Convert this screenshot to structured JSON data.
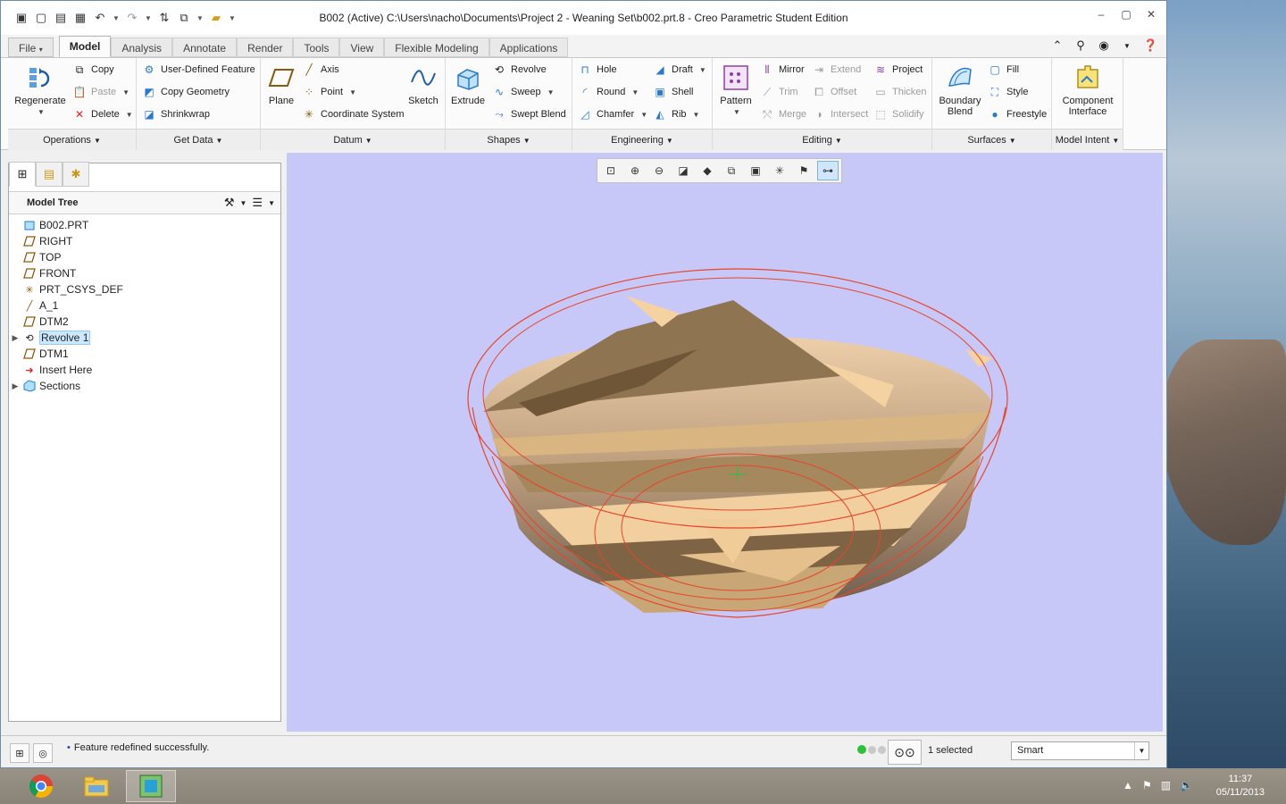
{
  "window": {
    "title": "B002 (Active) C:\\Users\\nacho\\Documents\\Project 2 - Weaning Set\\b002.prt.8 - Creo Parametric Student Edition"
  },
  "tabs": [
    {
      "label": "File",
      "id": "file"
    },
    {
      "label": "Model",
      "id": "model"
    },
    {
      "label": "Analysis",
      "id": "analysis"
    },
    {
      "label": "Annotate",
      "id": "annotate"
    },
    {
      "label": "Render",
      "id": "render"
    },
    {
      "label": "Tools",
      "id": "tools"
    },
    {
      "label": "View",
      "id": "view"
    },
    {
      "label": "Flexible Modeling",
      "id": "flexible"
    },
    {
      "label": "Applications",
      "id": "applications"
    }
  ],
  "ribbon": {
    "operations": {
      "label": "Operations",
      "regenerate": "Regenerate",
      "copy": "Copy",
      "paste": "Paste",
      "delete": "Delete"
    },
    "getdata": {
      "label": "Get Data",
      "udf": "User-Defined Feature",
      "copy_geometry": "Copy Geometry",
      "shrinkwrap": "Shrinkwrap"
    },
    "datum": {
      "label": "Datum",
      "plane": "Plane",
      "axis": "Axis",
      "point": "Point",
      "csys": "Coordinate System",
      "sketch": "Sketch"
    },
    "shapes": {
      "label": "Shapes",
      "extrude": "Extrude",
      "revolve": "Revolve",
      "sweep": "Sweep",
      "swept_blend": "Swept Blend"
    },
    "engineering": {
      "label": "Engineering",
      "hole": "Hole",
      "round": "Round",
      "chamfer": "Chamfer",
      "draft": "Draft",
      "shell": "Shell",
      "rib": "Rib"
    },
    "editing": {
      "label": "Editing",
      "pattern": "Pattern",
      "mirror": "Mirror",
      "trim": "Trim",
      "merge": "Merge",
      "extend": "Extend",
      "offset": "Offset",
      "intersect": "Intersect",
      "project": "Project",
      "thicken": "Thicken",
      "solidify": "Solidify"
    },
    "surfaces": {
      "label": "Surfaces",
      "boundary_blend_1": "Boundary",
      "boundary_blend_2": "Blend",
      "fill": "Fill",
      "style": "Style",
      "freestyle": "Freestyle"
    },
    "model_intent": {
      "label": "Model Intent",
      "component_1": "Component",
      "component_2": "Interface"
    }
  },
  "model_tree": {
    "title": "Model Tree",
    "items": [
      {
        "label": "B002.PRT",
        "icon": "part-icon",
        "expander": ""
      },
      {
        "label": "RIGHT",
        "icon": "datum-plane-icon",
        "expander": ""
      },
      {
        "label": "TOP",
        "icon": "datum-plane-icon",
        "expander": ""
      },
      {
        "label": "FRONT",
        "icon": "datum-plane-icon",
        "expander": ""
      },
      {
        "label": "PRT_CSYS_DEF",
        "icon": "csys-icon",
        "expander": ""
      },
      {
        "label": "A_1",
        "icon": "axis-icon",
        "expander": ""
      },
      {
        "label": "DTM2",
        "icon": "datum-plane-icon",
        "expander": ""
      },
      {
        "label": "Revolve 1",
        "icon": "revolve-icon",
        "expander": "▶",
        "selected": true
      },
      {
        "label": "DTM1",
        "icon": "datum-plane-icon",
        "expander": ""
      },
      {
        "label": "Insert Here",
        "icon": "insert-here-icon",
        "expander": ""
      },
      {
        "label": "Sections",
        "icon": "sections-icon",
        "expander": "▶"
      }
    ]
  },
  "status": {
    "message": "Feature redefined successfully.",
    "selected": "1 selected",
    "filter": "Smart"
  },
  "clock": {
    "time": "11:37",
    "date": "05/11/2013"
  },
  "colors": {
    "viewport_bg": "#c8c8f8",
    "model_light": "#f5d3a5",
    "model_dark": "#6b5434",
    "edge_highlight": "#e8452a",
    "selection_bg": "#cce8ff"
  }
}
